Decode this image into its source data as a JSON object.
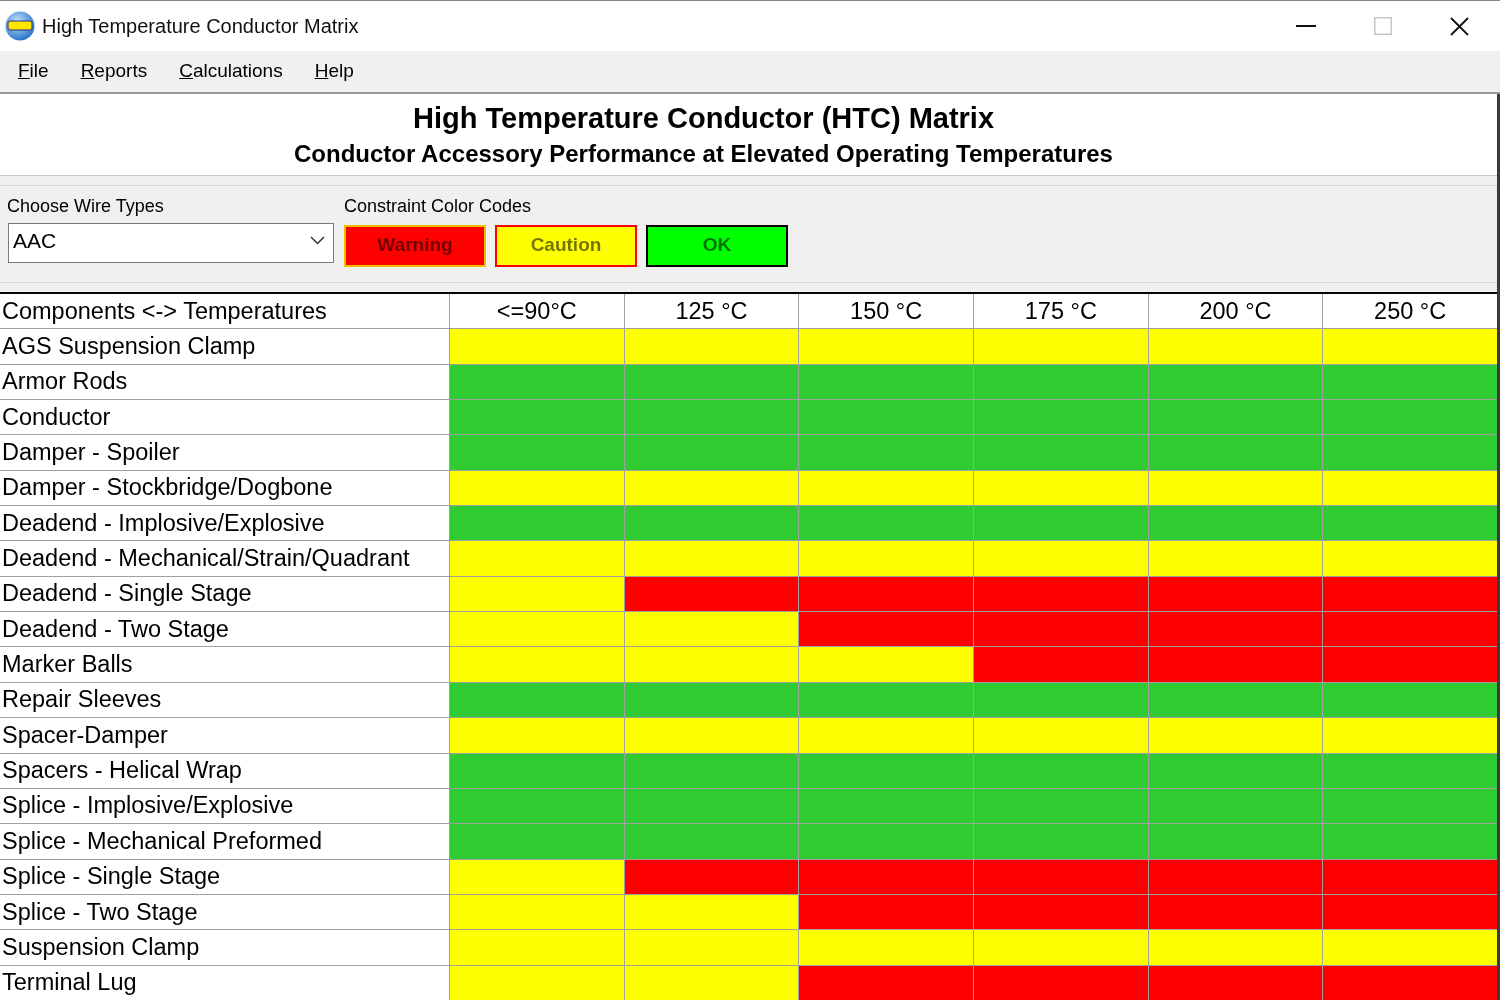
{
  "window": {
    "title": "High Temperature Conductor Matrix",
    "maximize_disabled": true
  },
  "menu": [
    "File",
    "Reports",
    "Calculations",
    "Help"
  ],
  "header": {
    "title": "High Temperature Conductor (HTC) Matrix",
    "subtitle": "Conductor Accessory Performance at Elevated Operating Temperatures"
  },
  "wire_type": {
    "label": "Choose Wire Types",
    "value": "AAC"
  },
  "legend": {
    "label": "Constraint Color Codes",
    "items": [
      {
        "label": "Warning",
        "color": "#ff0000"
      },
      {
        "label": "Caution",
        "color": "#ffff00"
      },
      {
        "label": "OK",
        "color": "#00ff00"
      }
    ]
  },
  "table": {
    "columns": [
      "Components <-> Temperatures",
      "<=90°C",
      "125 °C",
      "150 °C",
      "175 °C",
      "200 °C",
      "250 °C"
    ],
    "rows": [
      {
        "label": "AGS Suspension Clamp",
        "cells": [
          {
            "color": "#ffff00"
          },
          {
            "color": "#ffff00"
          },
          {
            "color": "#ffff00"
          },
          {
            "color": "#ffff00"
          },
          {
            "color": "#ffff00"
          },
          {
            "color": "#ffff00"
          }
        ]
      },
      {
        "label": "Armor Rods",
        "cells": [
          {
            "color": "#2ecc32"
          },
          {
            "color": "#2ecc32"
          },
          {
            "color": "#2ecc32"
          },
          {
            "color": "#2ecc32"
          },
          {
            "color": "#2ecc32"
          },
          {
            "color": "#2ecc32"
          }
        ]
      },
      {
        "label": "Conductor",
        "cells": [
          {
            "color": "#2ecc32"
          },
          {
            "color": "#2ecc32"
          },
          {
            "color": "#2ecc32"
          },
          {
            "color": "#2ecc32"
          },
          {
            "color": "#2ecc32"
          },
          {
            "color": "#2ecc32"
          }
        ]
      },
      {
        "label": "Damper - Spoiler",
        "cells": [
          {
            "color": "#2ecc32"
          },
          {
            "color": "#2ecc32"
          },
          {
            "color": "#2ecc32"
          },
          {
            "color": "#2ecc32"
          },
          {
            "color": "#2ecc32"
          },
          {
            "color": "#2ecc32"
          }
        ]
      },
      {
        "label": "Damper - Stockbridge/Dogbone",
        "cells": [
          {
            "color": "#ffff00"
          },
          {
            "color": "#ffff00"
          },
          {
            "color": "#ffff00"
          },
          {
            "color": "#ffff00"
          },
          {
            "color": "#ffff00"
          },
          {
            "color": "#ffff00"
          }
        ]
      },
      {
        "label": "Deadend - Implosive/Explosive",
        "cells": [
          {
            "color": "#2ecc32"
          },
          {
            "color": "#2ecc32"
          },
          {
            "color": "#2ecc32"
          },
          {
            "color": "#2ecc32"
          },
          {
            "color": "#2ecc32"
          },
          {
            "color": "#2ecc32"
          }
        ]
      },
      {
        "label": "Deadend - Mechanical/Strain/Quadrant",
        "cells": [
          {
            "color": "#ffff00"
          },
          {
            "color": "#ffff00"
          },
          {
            "color": "#ffff00"
          },
          {
            "color": "#ffff00"
          },
          {
            "color": "#ffff00"
          },
          {
            "color": "#ffff00"
          }
        ]
      },
      {
        "label": "Deadend - Single Stage",
        "cells": [
          {
            "color": "#ffff00"
          },
          {
            "color": "#ff0000"
          },
          {
            "color": "#ff0000"
          },
          {
            "color": "#ff0000"
          },
          {
            "color": "#ff0000"
          },
          {
            "color": "#ff0000"
          }
        ]
      },
      {
        "label": "Deadend - Two Stage",
        "cells": [
          {
            "color": "#ffff00"
          },
          {
            "color": "#ffff00"
          },
          {
            "color": "#ff0000"
          },
          {
            "color": "#ff0000"
          },
          {
            "color": "#ff0000"
          },
          {
            "color": "#ff0000"
          }
        ]
      },
      {
        "label": "Marker Balls",
        "cells": [
          {
            "color": "#ffff00"
          },
          {
            "color": "#ffff00"
          },
          {
            "color": "#ffff00"
          },
          {
            "color": "#ff0000"
          },
          {
            "color": "#ff0000"
          },
          {
            "color": "#ff0000"
          }
        ]
      },
      {
        "label": "Repair Sleeves",
        "cells": [
          {
            "color": "#2ecc32"
          },
          {
            "color": "#2ecc32"
          },
          {
            "color": "#2ecc32"
          },
          {
            "color": "#2ecc32"
          },
          {
            "color": "#2ecc32"
          },
          {
            "color": "#2ecc32"
          }
        ]
      },
      {
        "label": "Spacer-Damper",
        "cells": [
          {
            "color": "#ffff00"
          },
          {
            "color": "#ffff00"
          },
          {
            "color": "#ffff00"
          },
          {
            "color": "#ffff00"
          },
          {
            "color": "#ffff00"
          },
          {
            "color": "#ffff00"
          }
        ]
      },
      {
        "label": "Spacers - Helical Wrap",
        "cells": [
          {
            "color": "#2ecc32"
          },
          {
            "color": "#2ecc32"
          },
          {
            "color": "#2ecc32"
          },
          {
            "color": "#2ecc32"
          },
          {
            "color": "#2ecc32"
          },
          {
            "color": "#2ecc32"
          }
        ]
      },
      {
        "label": "Splice - Implosive/Explosive",
        "cells": [
          {
            "color": "#2ecc32"
          },
          {
            "color": "#2ecc32"
          },
          {
            "color": "#2ecc32"
          },
          {
            "color": "#2ecc32"
          },
          {
            "color": "#2ecc32"
          },
          {
            "color": "#2ecc32"
          }
        ]
      },
      {
        "label": "Splice - Mechanical Preformed",
        "cells": [
          {
            "color": "#2ecc32"
          },
          {
            "color": "#2ecc32"
          },
          {
            "color": "#2ecc32"
          },
          {
            "color": "#2ecc32"
          },
          {
            "color": "#2ecc32"
          },
          {
            "color": "#2ecc32"
          }
        ]
      },
      {
        "label": "Splice - Single Stage",
        "cells": [
          {
            "color": "#ffff00"
          },
          {
            "color": "#ff0000"
          },
          {
            "color": "#ff0000"
          },
          {
            "color": "#ff0000"
          },
          {
            "color": "#ff0000"
          },
          {
            "color": "#ff0000"
          }
        ]
      },
      {
        "label": "Splice - Two Stage",
        "cells": [
          {
            "color": "#ffff00"
          },
          {
            "color": "#ffff00"
          },
          {
            "color": "#ff0000"
          },
          {
            "color": "#ff0000"
          },
          {
            "color": "#ff0000"
          },
          {
            "color": "#ff0000"
          }
        ]
      },
      {
        "label": "Suspension Clamp",
        "cells": [
          {
            "color": "#ffff00"
          },
          {
            "color": "#ffff00"
          },
          {
            "color": "#ffff00"
          },
          {
            "color": "#ffff00"
          },
          {
            "color": "#ffff00"
          },
          {
            "color": "#ffff00"
          }
        ]
      },
      {
        "label": "Terminal Lug",
        "cells": [
          {
            "color": "#ffff00"
          },
          {
            "color": "#ffff00"
          },
          {
            "color": "#ff0000"
          },
          {
            "color": "#ff0000"
          },
          {
            "color": "#ff0000"
          },
          {
            "color": "#ff0000"
          }
        ]
      }
    ]
  }
}
